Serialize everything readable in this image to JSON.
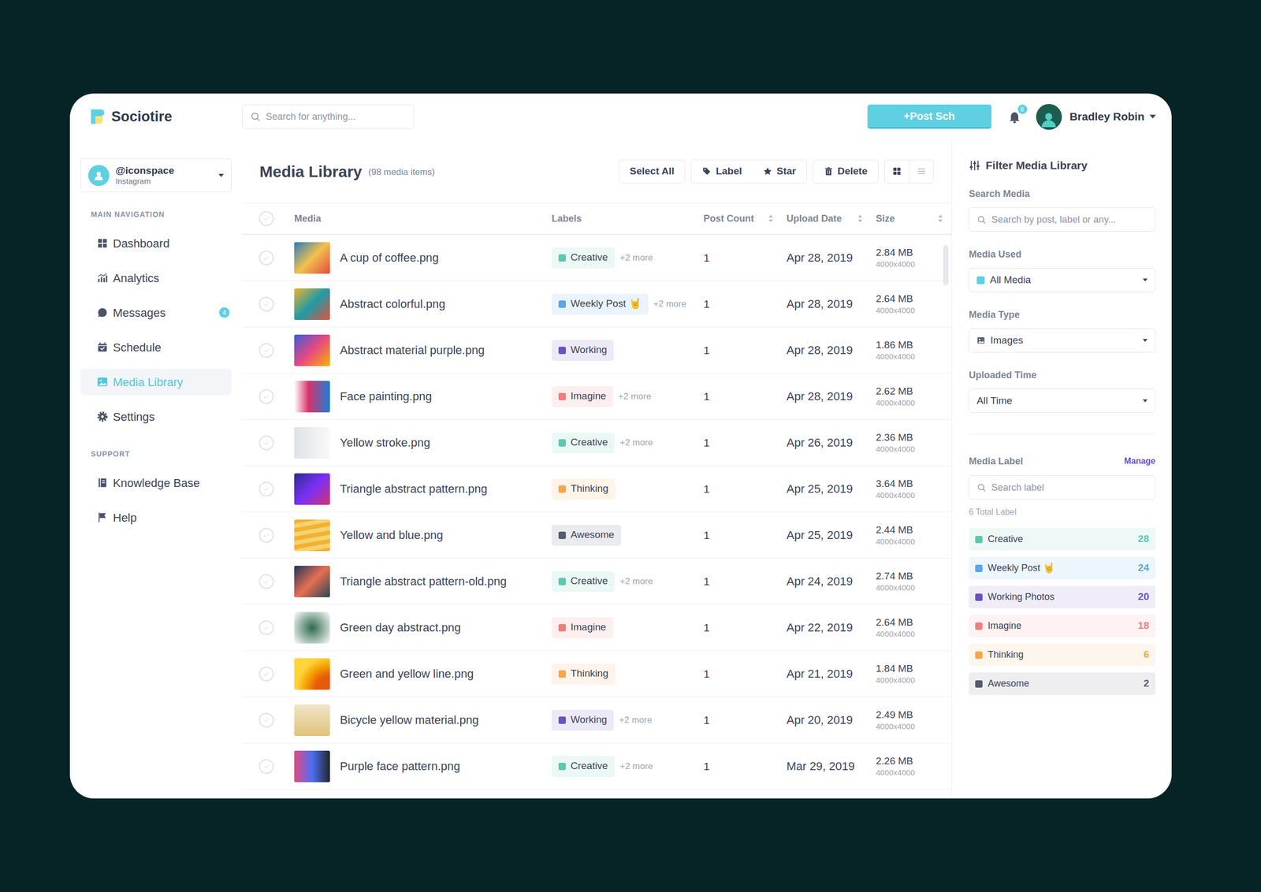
{
  "brand": {
    "name": "Sociotire"
  },
  "search": {
    "placeholder": "Search for anything..."
  },
  "header": {
    "post_button": "+Post Sch",
    "notifications": "6",
    "user": "Bradley Robin"
  },
  "account": {
    "handle": "@iconspace",
    "network": "Instagram"
  },
  "sidebar": {
    "main_heading": "MAIN NAVIGATION",
    "items": [
      {
        "label": "Dashboard",
        "kind": "dashboard",
        "selected": false,
        "badge": ""
      },
      {
        "label": "Analytics",
        "kind": "analytics",
        "selected": false,
        "badge": ""
      },
      {
        "label": "Messages",
        "kind": "messages",
        "selected": false,
        "badge": "4"
      },
      {
        "label": "Schedule",
        "kind": "schedule",
        "selected": false,
        "badge": ""
      },
      {
        "label": "Media Library",
        "kind": "media",
        "selected": true,
        "badge": ""
      },
      {
        "label": "Settings",
        "kind": "settings",
        "selected": false,
        "badge": ""
      }
    ],
    "support_heading": "SUPPORT",
    "support_items": [
      {
        "label": "Knowledge Base",
        "kind": "book",
        "selected": false
      },
      {
        "label": "Help",
        "kind": "flag",
        "selected": false
      }
    ]
  },
  "library": {
    "title": "Media Library",
    "count": "(98 media items)",
    "actions": [
      {
        "label": "Select All",
        "kind": "plain"
      },
      {
        "label": "Label",
        "kind": "tag"
      },
      {
        "label": "Star",
        "kind": "star"
      },
      {
        "label": "Delete",
        "kind": "trash"
      }
    ],
    "views": [
      {
        "kind": "grid",
        "selected": true
      },
      {
        "kind": "list",
        "selected": false
      }
    ]
  },
  "table": {
    "all_checked": false,
    "scroll": 0,
    "columns": [
      {
        "label": "Media",
        "sortable": false
      },
      {
        "label": "Labels",
        "sortable": false
      },
      {
        "label": "Post Count",
        "sortable": true
      },
      {
        "label": "Upload Date",
        "sortable": true
      },
      {
        "label": "Size",
        "sortable": true
      }
    ],
    "rows": [
      {
        "name": "A cup of coffee.png",
        "label": {
          "text": "Creative",
          "color": "#5cc8b2"
        },
        "more": "+2 more",
        "posts": "1",
        "date": "Apr 28, 2019",
        "size": "2.84 MB",
        "dims": "4000x4000",
        "checked": false
      },
      {
        "name": "Abstract colorful.png",
        "label": {
          "text": "Weekly Post 🤘",
          "color": "#5aa7e8"
        },
        "more": "+2 more",
        "posts": "1",
        "date": "Apr 28, 2019",
        "size": "2.64 MB",
        "dims": "4000x4000",
        "checked": false
      },
      {
        "name": "Abstract material purple.png",
        "label": {
          "text": "Working",
          "color": "#6a52c6"
        },
        "more": "",
        "posts": "1",
        "date": "Apr 28, 2019",
        "size": "1.86 MB",
        "dims": "4000x4000",
        "checked": false
      },
      {
        "name": "Face painting.png",
        "label": {
          "text": "Imagine",
          "color": "#f27d7d"
        },
        "more": "+2 more",
        "posts": "1",
        "date": "Apr 28, 2019",
        "size": "2.62 MB",
        "dims": "4000x4000",
        "checked": false
      },
      {
        "name": "Yellow stroke.png",
        "label": {
          "text": "Creative",
          "color": "#5cc8b2"
        },
        "more": "+2 more",
        "posts": "1",
        "date": "Apr 26, 2019",
        "size": "2.36 MB",
        "dims": "4000x4000",
        "checked": false
      },
      {
        "name": "Triangle abstract pattern.png",
        "label": {
          "text": "Thinking",
          "color": "#f7a64a"
        },
        "more": "",
        "posts": "1",
        "date": "Apr 25, 2019",
        "size": "3.64 MB",
        "dims": "4000x4000",
        "checked": false
      },
      {
        "name": "Yellow and blue.png",
        "label": {
          "text": "Awesome",
          "color": "#545d70"
        },
        "more": "",
        "posts": "1",
        "date": "Apr 25, 2019",
        "size": "2.44 MB",
        "dims": "4000x4000",
        "checked": false
      },
      {
        "name": "Triangle abstract pattern-old.png",
        "label": {
          "text": "Creative",
          "color": "#5cc8b2"
        },
        "more": "+2 more",
        "posts": "1",
        "date": "Apr 24, 2019",
        "size": "2.74 MB",
        "dims": "4000x4000",
        "checked": false
      },
      {
        "name": "Green day abstract.png",
        "label": {
          "text": "Imagine",
          "color": "#f27d7d"
        },
        "more": "",
        "posts": "1",
        "date": "Apr 22, 2019",
        "size": "2.64 MB",
        "dims": "4000x4000",
        "checked": false
      },
      {
        "name": "Green and yellow line.png",
        "label": {
          "text": "Thinking",
          "color": "#f7a64a"
        },
        "more": "",
        "posts": "1",
        "date": "Apr 21, 2019",
        "size": "1.84 MB",
        "dims": "4000x4000",
        "checked": false
      },
      {
        "name": "Bicycle yellow material.png",
        "label": {
          "text": "Working",
          "color": "#6a52c6"
        },
        "more": "+2 more",
        "posts": "1",
        "date": "Apr 20, 2019",
        "size": "2.49 MB",
        "dims": "4000x4000",
        "checked": false
      },
      {
        "name": "Purple face pattern.png",
        "label": {
          "text": "Creative",
          "color": "#5cc8b2"
        },
        "more": "+2 more",
        "posts": "1",
        "date": "Mar 29, 2019",
        "size": "2.26 MB",
        "dims": "4000x4000",
        "checked": false
      }
    ]
  },
  "filter": {
    "title": "Filter Media Library",
    "search_label": "Search Media",
    "search_placeholder": "Search by post, label or any...",
    "selects": [
      {
        "label": "Media Used",
        "value": "All Media",
        "kind": "swatch"
      },
      {
        "label": "Media Type",
        "value": "Images",
        "kind": "image"
      },
      {
        "label": "Uploaded Time",
        "value": "All Time",
        "kind": "plain"
      }
    ],
    "labels_heading": "Media Label",
    "manage": "Manage",
    "label_search_placeholder": "Search label",
    "total": "6 Total Label",
    "labels": [
      {
        "text": "Creative",
        "count": "28",
        "color": "#5cc8b2"
      },
      {
        "text": "Weekly Post 🤘",
        "count": "24",
        "color": "#5aa7e8"
      },
      {
        "text": "Working Photos",
        "count": "20",
        "color": "#6a52c6"
      },
      {
        "text": "Imagine",
        "count": "18",
        "color": "#f27d7d"
      },
      {
        "text": "Thinking",
        "count": "6",
        "color": "#f7a64a"
      },
      {
        "text": "Awesome",
        "count": "2",
        "color": "#545d70"
      }
    ]
  }
}
